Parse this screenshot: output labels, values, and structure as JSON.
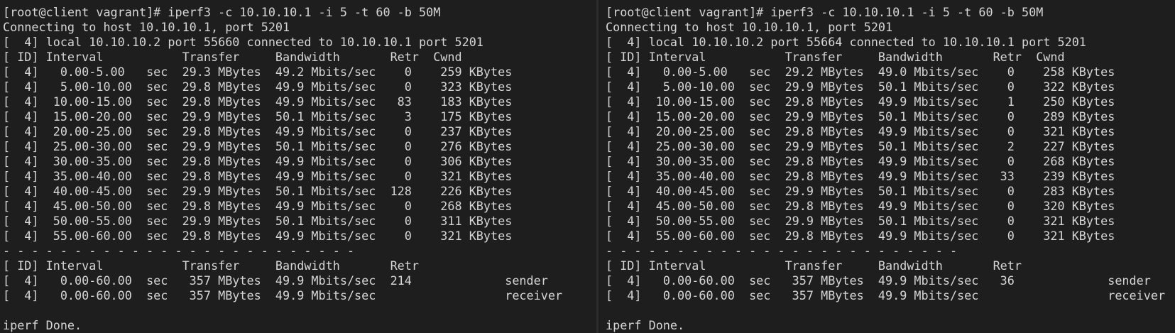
{
  "terminals": [
    {
      "lines": [
        "[root@client vagrant]# iperf3 -c 10.10.10.1 -i 5 -t 60 -b 50M",
        "Connecting to host 10.10.10.1, port 5201",
        "[  4] local 10.10.10.2 port 55660 connected to 10.10.10.1 port 5201",
        "[ ID] Interval           Transfer     Bandwidth       Retr  Cwnd",
        "[  4]   0.00-5.00   sec  29.3 MBytes  49.2 Mbits/sec    0    259 KBytes",
        "[  4]   5.00-10.00  sec  29.8 MBytes  49.9 Mbits/sec    0    323 KBytes",
        "[  4]  10.00-15.00  sec  29.8 MBytes  49.9 Mbits/sec   83    183 KBytes",
        "[  4]  15.00-20.00  sec  29.9 MBytes  50.1 Mbits/sec    3    175 KBytes",
        "[  4]  20.00-25.00  sec  29.8 MBytes  49.9 Mbits/sec    0    237 KBytes",
        "[  4]  25.00-30.00  sec  29.9 MBytes  50.1 Mbits/sec    0    276 KBytes",
        "[  4]  30.00-35.00  sec  29.8 MBytes  49.9 Mbits/sec    0    306 KBytes",
        "[  4]  35.00-40.00  sec  29.8 MBytes  49.9 Mbits/sec    0    321 KBytes",
        "[  4]  40.00-45.00  sec  29.9 MBytes  50.1 Mbits/sec  128    226 KBytes",
        "[  4]  45.00-50.00  sec  29.8 MBytes  49.9 Mbits/sec    0    268 KBytes",
        "[  4]  50.00-55.00  sec  29.9 MBytes  50.1 Mbits/sec    0    311 KBytes",
        "[  4]  55.00-60.00  sec  29.8 MBytes  49.9 Mbits/sec    0    321 KBytes",
        "- - - - - - - - - - - - - - - - - - - - - - - - -",
        "[ ID] Interval           Transfer     Bandwidth       Retr",
        "[  4]   0.00-60.00  sec   357 MBytes  49.9 Mbits/sec  214             sender",
        "[  4]   0.00-60.00  sec   357 MBytes  49.9 Mbits/sec                  receiver",
        "",
        "iperf Done."
      ]
    },
    {
      "lines": [
        "[root@client vagrant]# iperf3 -c 10.10.10.1 -i 5 -t 60 -b 50M",
        "Connecting to host 10.10.10.1, port 5201",
        "[  4] local 10.10.10.2 port 55664 connected to 10.10.10.1 port 5201",
        "[ ID] Interval           Transfer     Bandwidth       Retr  Cwnd",
        "[  4]   0.00-5.00   sec  29.2 MBytes  49.0 Mbits/sec    0    258 KBytes",
        "[  4]   5.00-10.00  sec  29.9 MBytes  50.1 Mbits/sec    0    322 KBytes",
        "[  4]  10.00-15.00  sec  29.8 MBytes  49.9 Mbits/sec    1    250 KBytes",
        "[  4]  15.00-20.00  sec  29.9 MBytes  50.1 Mbits/sec    0    289 KBytes",
        "[  4]  20.00-25.00  sec  29.8 MBytes  49.9 Mbits/sec    0    321 KBytes",
        "[  4]  25.00-30.00  sec  29.9 MBytes  50.1 Mbits/sec    2    227 KBytes",
        "[  4]  30.00-35.00  sec  29.8 MBytes  49.9 Mbits/sec    0    268 KBytes",
        "[  4]  35.00-40.00  sec  29.8 MBytes  49.9 Mbits/sec   33    239 KBytes",
        "[  4]  40.00-45.00  sec  29.9 MBytes  50.1 Mbits/sec    0    283 KBytes",
        "[  4]  45.00-50.00  sec  29.8 MBytes  49.9 Mbits/sec    0    320 KBytes",
        "[  4]  50.00-55.00  sec  29.9 MBytes  50.1 Mbits/sec    0    321 KBytes",
        "[  4]  55.00-60.00  sec  29.8 MBytes  49.9 Mbits/sec    0    321 KBytes",
        "- - - - - - - - - - - - - - - - - - - - - - - - -",
        "[ ID] Interval           Transfer     Bandwidth       Retr",
        "[  4]   0.00-60.00  sec   357 MBytes  49.9 Mbits/sec   36             sender",
        "[  4]   0.00-60.00  sec   357 MBytes  49.9 Mbits/sec                  receiver",
        "",
        "iperf Done."
      ]
    }
  ]
}
